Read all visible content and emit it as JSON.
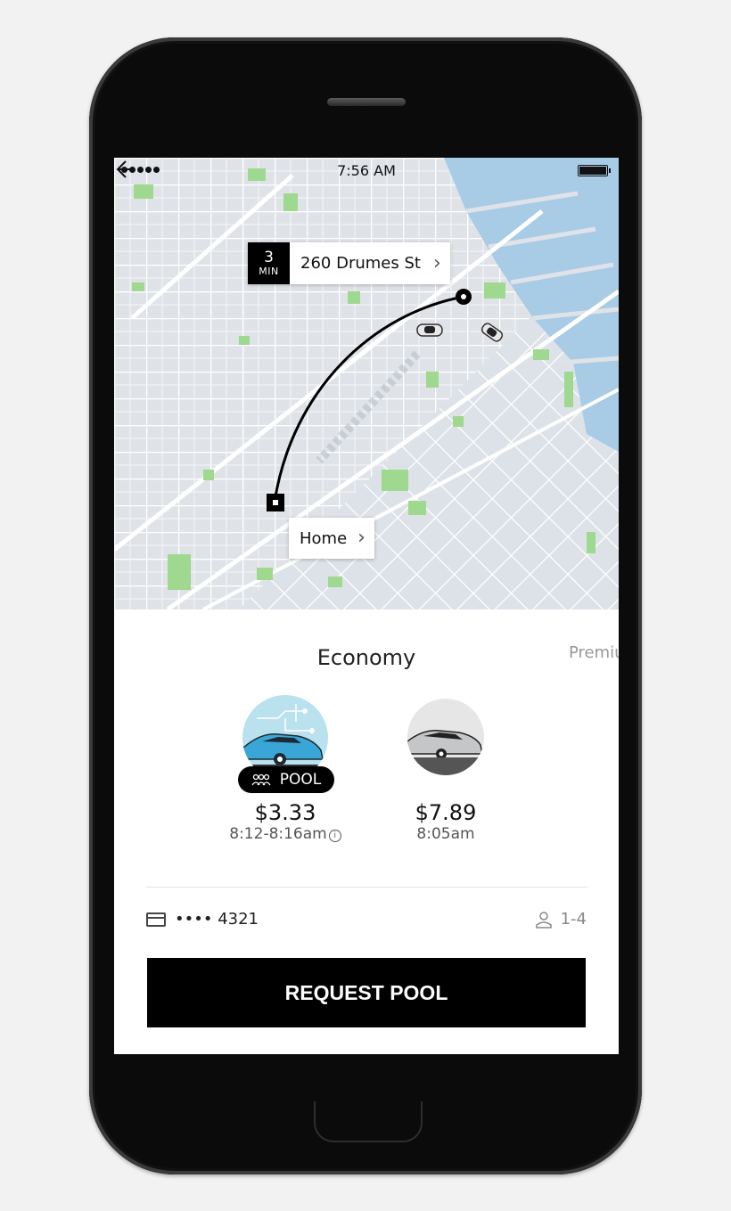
{
  "status_bar": {
    "time": "7:56 AM"
  },
  "map": {
    "pickup": {
      "eta_minutes": "3",
      "eta_unit": "MIN",
      "address": "260 Drumes St"
    },
    "destination": {
      "label": "Home"
    }
  },
  "ride_panel": {
    "tabs": [
      "Economy",
      "Premium"
    ],
    "options": [
      {
        "badge": "POOL",
        "price": "$3.33",
        "eta": "8:12-8:16am",
        "selected": true
      },
      {
        "price": "$7.89",
        "eta": "8:05am",
        "selected": false
      }
    ],
    "payment": {
      "card_mask": "•••• 4321"
    },
    "seats": "1-4",
    "request_button": "REQUEST POOL"
  },
  "colors": {
    "water": "#a8cbe6",
    "park": "#9fd88f",
    "map_bg": "#dfe3e8",
    "pool_car": "#3aa6d8"
  }
}
